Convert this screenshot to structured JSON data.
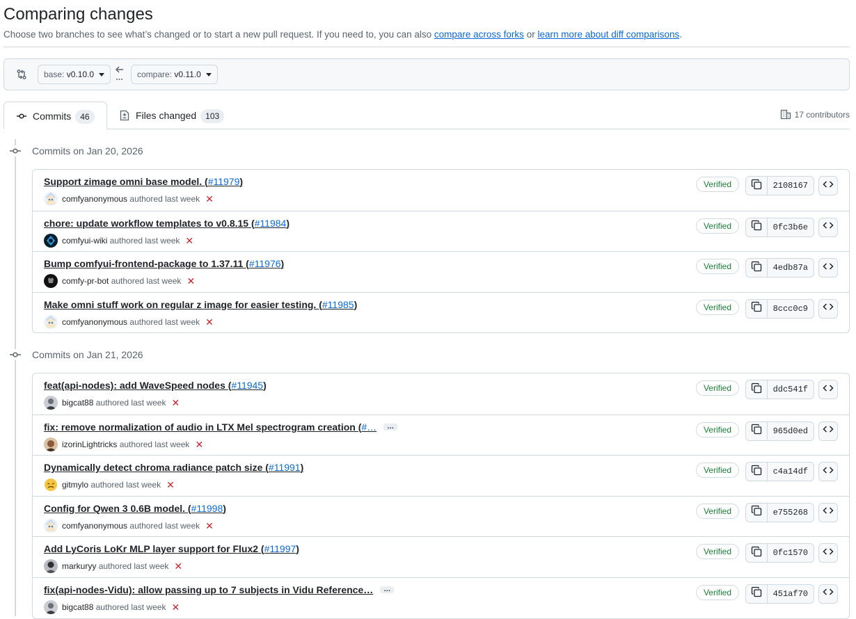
{
  "header": {
    "title": "Comparing changes",
    "subtitle_prefix": "Choose two branches to see what’s changed or to start a new pull request. If you need to, you can also ",
    "link_forks": "compare across forks",
    "subtitle_or": " or ",
    "link_learn": "learn more about diff comparisons",
    "subtitle_suffix": "."
  },
  "range": {
    "base_prefix": "base: ",
    "base_value": "v0.10.0",
    "compare_prefix": "compare: ",
    "compare_value": "v0.11.0"
  },
  "tabs": {
    "commits_label": "Commits",
    "commits_count": "46",
    "files_label": "Files changed",
    "files_count": "103"
  },
  "contributors": "17 contributors",
  "groups": [
    {
      "date": "Commits on Jan 20, 2026",
      "commits": [
        {
          "title": "Support zimage omni base model. (",
          "pr": "#11979",
          "close": ")",
          "truncated": false,
          "author": "comfyanonymous",
          "when": "authored last week",
          "verified": "Verified",
          "sha": "2108167",
          "avatar": "anime"
        },
        {
          "title": "chore: update workflow templates to v0.8.15 (",
          "pr": "#11984",
          "close": ")",
          "truncated": false,
          "author": "comfyui-wiki",
          "when": "authored last week",
          "verified": "Verified",
          "sha": "0fc3b6e",
          "avatar": "dark-blue"
        },
        {
          "title": "Bump comfyui-frontend-package to 1.37.11 (",
          "pr": "#11976",
          "close": ")",
          "truncated": false,
          "author": "comfy-pr-bot",
          "when": "authored last week",
          "verified": "Verified",
          "sha": "4edb87a",
          "avatar": "black"
        },
        {
          "title": "Make omni stuff work on regular z image for easier testing. (",
          "pr": "#11985",
          "close": ")",
          "truncated": false,
          "author": "comfyanonymous",
          "when": "authored last week",
          "verified": "Verified",
          "sha": "8ccc0c9",
          "avatar": "anime"
        }
      ]
    },
    {
      "date": "Commits on Jan 21, 2026",
      "commits": [
        {
          "title": "feat(api-nodes): add WaveSpeed nodes (",
          "pr": "#11945",
          "close": ")",
          "truncated": false,
          "author": "bigcat88",
          "when": "authored last week",
          "verified": "Verified",
          "sha": "ddc541f",
          "avatar": "photo-gray"
        },
        {
          "title": "fix: remove normalization of audio in LTX Mel spectrogram creation (",
          "pr": "#…",
          "close": "",
          "truncated": true,
          "author": "izorinLightricks",
          "when": "authored last week",
          "verified": "Verified",
          "sha": "965d0ed",
          "avatar": "photo-brown"
        },
        {
          "title": "Dynamically detect chroma radiance patch size (",
          "pr": "#11991",
          "close": ")",
          "truncated": false,
          "author": "gitmylo",
          "when": "authored last week",
          "verified": "Verified",
          "sha": "c4a14df",
          "avatar": "emoji"
        },
        {
          "title": "Config for Qwen 3 0.6B model. (",
          "pr": "#11998",
          "close": ")",
          "truncated": false,
          "author": "comfyanonymous",
          "when": "authored last week",
          "verified": "Verified",
          "sha": "e755268",
          "avatar": "anime"
        },
        {
          "title": "Add LyCoris LoKr MLP layer support for Flux2 (",
          "pr": "#11997",
          "close": ")",
          "truncated": false,
          "author": "markuryy",
          "when": "authored last week",
          "verified": "Verified",
          "sha": "0fc1570",
          "avatar": "photo-dark"
        },
        {
          "title": "fix(api-nodes-Vidu): allow passing up to 7 subjects in Vidu Reference…",
          "pr": "",
          "close": "",
          "truncated": true,
          "author": "bigcat88",
          "when": "authored last week",
          "verified": "Verified",
          "sha": "451af70",
          "avatar": "photo-gray"
        }
      ]
    }
  ],
  "labels": {
    "ellipsis": "…"
  },
  "icons": {
    "range": "git-compare-icon",
    "arrow": "arrow-left-icon",
    "commit": "git-commit-icon",
    "files": "file-diff-icon",
    "contributors": "organization-icon",
    "copy": "copy-icon",
    "browse": "code-icon",
    "unverified_status": "x-icon"
  },
  "colors": {
    "link": "#0969da",
    "verified": "#1a7f37",
    "failed": "#cf222e",
    "border": "#d1d9e0"
  }
}
